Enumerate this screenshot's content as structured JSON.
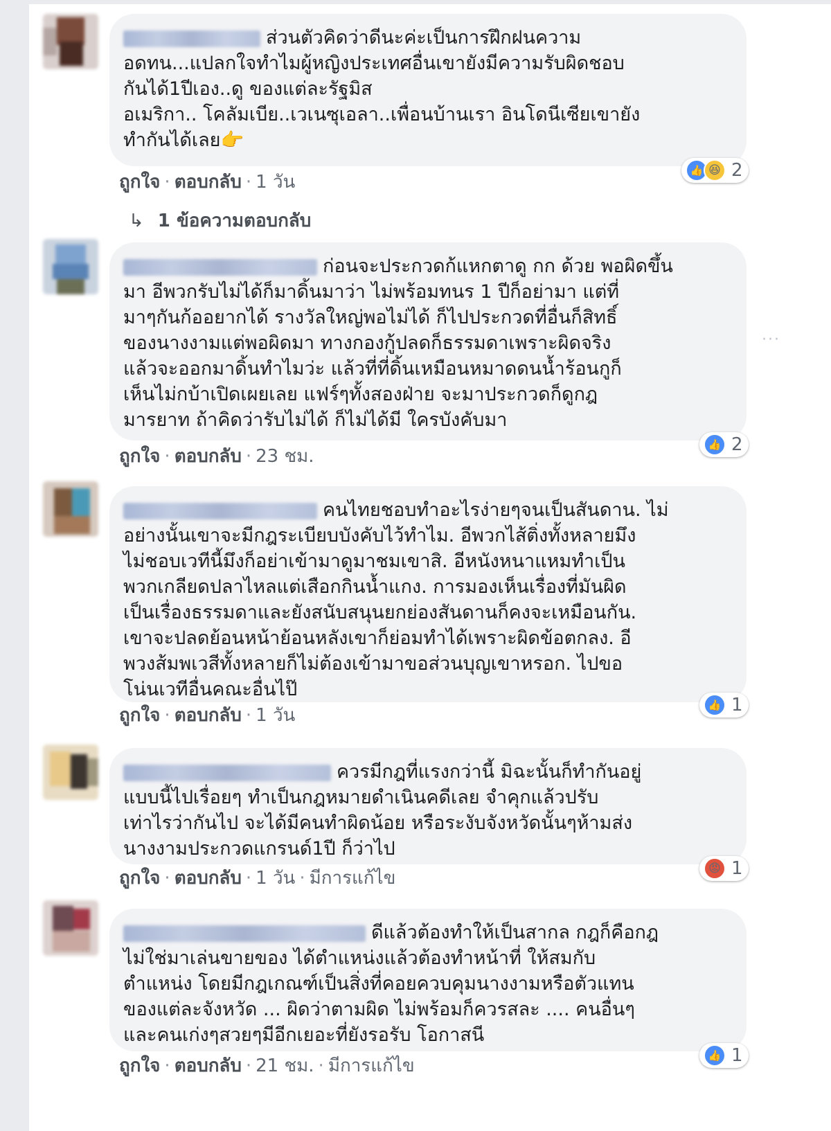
{
  "comments": [
    {
      "text": "ส่วนตัวคิดว่าดีนะค่ะเป็นการฝึกฝนความ\nอดทน...แปลกใจทำไมผู้หญิงประเทศอื่นเขายังมีความรับผิดชอบ\nกันได้1ปีเอง..ดู ของแต่ละรัฐมิส\nอเมริกา.. โคลัมเบีย..เวเนซุเอลา..เพื่อนบ้านเรา อินโดนีเซียเขายัง\nทำกันได้เลย👉",
      "like_label": "ถูกใจ",
      "reply_label": "ตอบกลับ",
      "time": "1 วัน",
      "edited": "",
      "reaction_count": "2",
      "reaction_icons": [
        "like-icon",
        "haha-icon"
      ]
    },
    {
      "text": "ก่อนจะประกวดก้แหกตาดู กก ด้วย พอผิดขึ้น\nมา อีพวกรับไม่ได้ก็มาดิ้นมาว่า ไม่พร้อมทนร 1 ปีก็อย่ามา แต่ที่\nมาๆกันก้ออยากได้ รางวัลใหญ่พอไม่ได้ ก็ไปประกวดที่อื่นก็สิทธิ์\nของนางงามแต่พอผิดมา ทางกองกู้ปลดก็ธรรมดาเพราะผิดจริง\nแล้วจะออกมาดิ้นทำไมว่ะ แล้วที่ที่ดิ้นเหมือนหมาดดนน้ำร้อนกูก็\nเห็นไม่กบ้าเปิดเผยเลย แฟร์ๆทั้งสองฝ่าย จะมาประกวดก็ดูกฎ\nมารยาท ถ้าคิดว่ารับไม่ได้ ก็ไม่ได้มี ใครบังคับมา",
      "like_label": "ถูกใจ",
      "reply_label": "ตอบกลับ",
      "time": "23 ชม.",
      "edited": "",
      "reaction_count": "2",
      "reaction_icons": [
        "like-icon"
      ]
    },
    {
      "text": "คนไทยชอบทำอะไรง่ายๆจนเป็นสันดาน. ไม่\nอย่างนั้นเขาจะมีกฎระเบียบบังคับไว้ทำไม. อีพวกไส้ติ่งทั้งหลายมึง\nไม่ชอบเวทีนี้มึงก็อย่าเข้ามาดูมาชมเขาสิ. อีหนังหนาแหมทำเป็น\nพวกเกลียดปลาไหลแต่เสือกกินน้ำแกง. การมองเห็นเรื่องที่มันผิด\nเป็นเรื่องธรรมดาและยังสนับสนุนยกย่องสันดานก็คงจะเหมือนกัน.\nเขาจะปลดย้อนหน้าย้อนหลังเขาก็ย่อมทำได้เพราะผิดข้อตกลง. อี\nพวงส้มพเวสีทั้งหลายก็ไม่ต้องเข้ามาขอส่วนบุญเขาหรอก. ไปขอ\nโน่นเวทีอื่นคณะอื่นไป๊",
      "like_label": "ถูกใจ",
      "reply_label": "ตอบกลับ",
      "time": "1 วัน",
      "edited": "",
      "reaction_count": "1",
      "reaction_icons": [
        "like-icon"
      ]
    },
    {
      "text": "ควรมีกฎที่แรงกว่านี้ มิฉะนั้นก็ทำกันอยู่\nแบบนี้ไปเรื่อยๆ ทำเป็นกฎหมายดำเนินคดีเลย จำคุกแล้วปรับ\nเท่าไรว่ากันไป จะได้มีคนทำผิดน้อย หรือระงับจังหวัดนั้นๆห้ามส่ง\nนางงามประกวดแกรนด์1ปี ก็ว่าไป",
      "like_label": "ถูกใจ",
      "reply_label": "ตอบกลับ",
      "time": "1 วัน",
      "edited": "มีการแก้ไข",
      "reaction_count": "1",
      "reaction_icons": [
        "angry-icon"
      ]
    },
    {
      "text": "ดีแล้วต้องทำให้เป็นสากล กฎก็คือกฎ\nไม่ใช่มาเล่นขายของ ได้ตำแหน่งแล้วต้องทำหน้าที่ ให้สมกับ\nตำแหน่ง โดยมีกฎเกณฑ์เป็นสิ่งที่คอยควบคุมนางงามหรือตัวแทน\nของแต่ละจังหวัด ... ผิดว่าตามผิด ไม่พร้อมก็ควรสละ .... คนอื่นๆ\nและคนเก่งๆสวยๆมีอีกเยอะที่ยังรอรับ โอกาสนี",
      "like_label": "ถูกใจ",
      "reply_label": "ตอบกลับ",
      "time": "21 ชม.",
      "edited": "มีการแก้ไข",
      "reaction_count": "1",
      "reaction_icons": [
        "like-icon"
      ]
    }
  ],
  "replies_link": "1 ข้อความตอบกลับ",
  "separator": "·"
}
